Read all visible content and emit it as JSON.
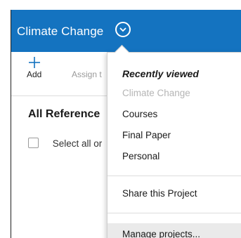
{
  "header": {
    "project_title": "Climate Change",
    "project_menu_icon": "chevron-down-circle-icon",
    "background_color": "#1473c0"
  },
  "toolbar": {
    "add_label": "Add",
    "add_icon": "plus-icon",
    "assign_label": "Assign t"
  },
  "main": {
    "section_title": "All Reference",
    "select_all_label": "Select all or"
  },
  "project_menu": {
    "heading": "Recently viewed",
    "recent_items": [
      {
        "label": "Climate Change",
        "current": true
      },
      {
        "label": "Courses"
      },
      {
        "label": "Final Paper"
      },
      {
        "label": "Personal"
      }
    ],
    "share_label": "Share this Project",
    "manage_label": "Manage projects..."
  }
}
